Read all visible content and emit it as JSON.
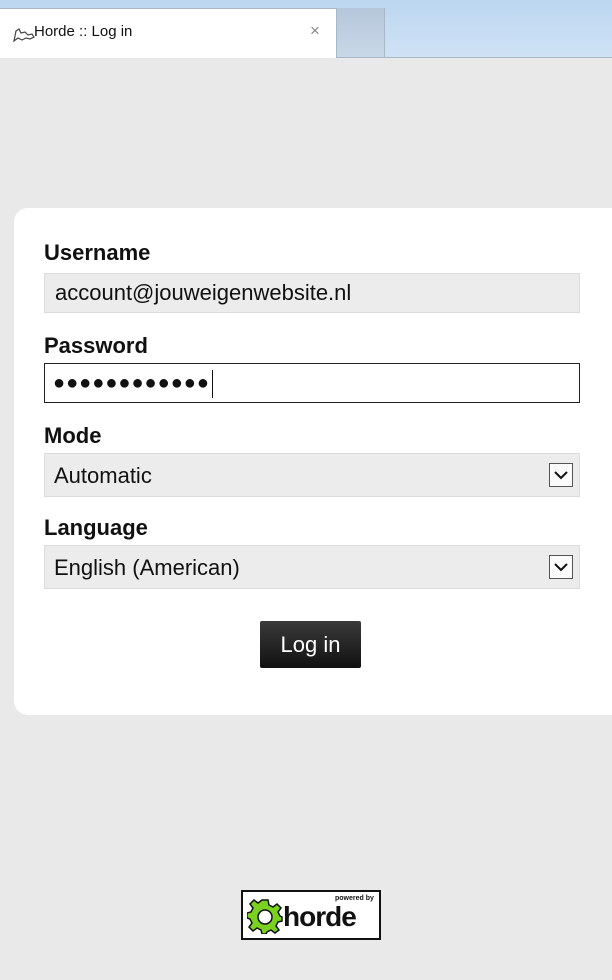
{
  "browser": {
    "tab_title": "Horde :: Log in",
    "close_symbol": "×",
    "favicon": "horde-favicon-icon"
  },
  "login": {
    "username_label": "Username",
    "username_value": "account@jouweigenwebsite.nl",
    "password_label": "Password",
    "password_mask": "●●●●●●●●●●●●",
    "mode_label": "Mode",
    "mode_value": "Automatic",
    "language_label": "Language",
    "language_value": "English (American)",
    "login_button": "Log in"
  },
  "footer": {
    "powered_by": "powered by",
    "brand": "horde"
  },
  "colors": {
    "page_bg": "#e9e9e9",
    "card_bg": "#ffffff",
    "button_bg": "#1a1a1a",
    "logo_green": "#7bd11f"
  }
}
